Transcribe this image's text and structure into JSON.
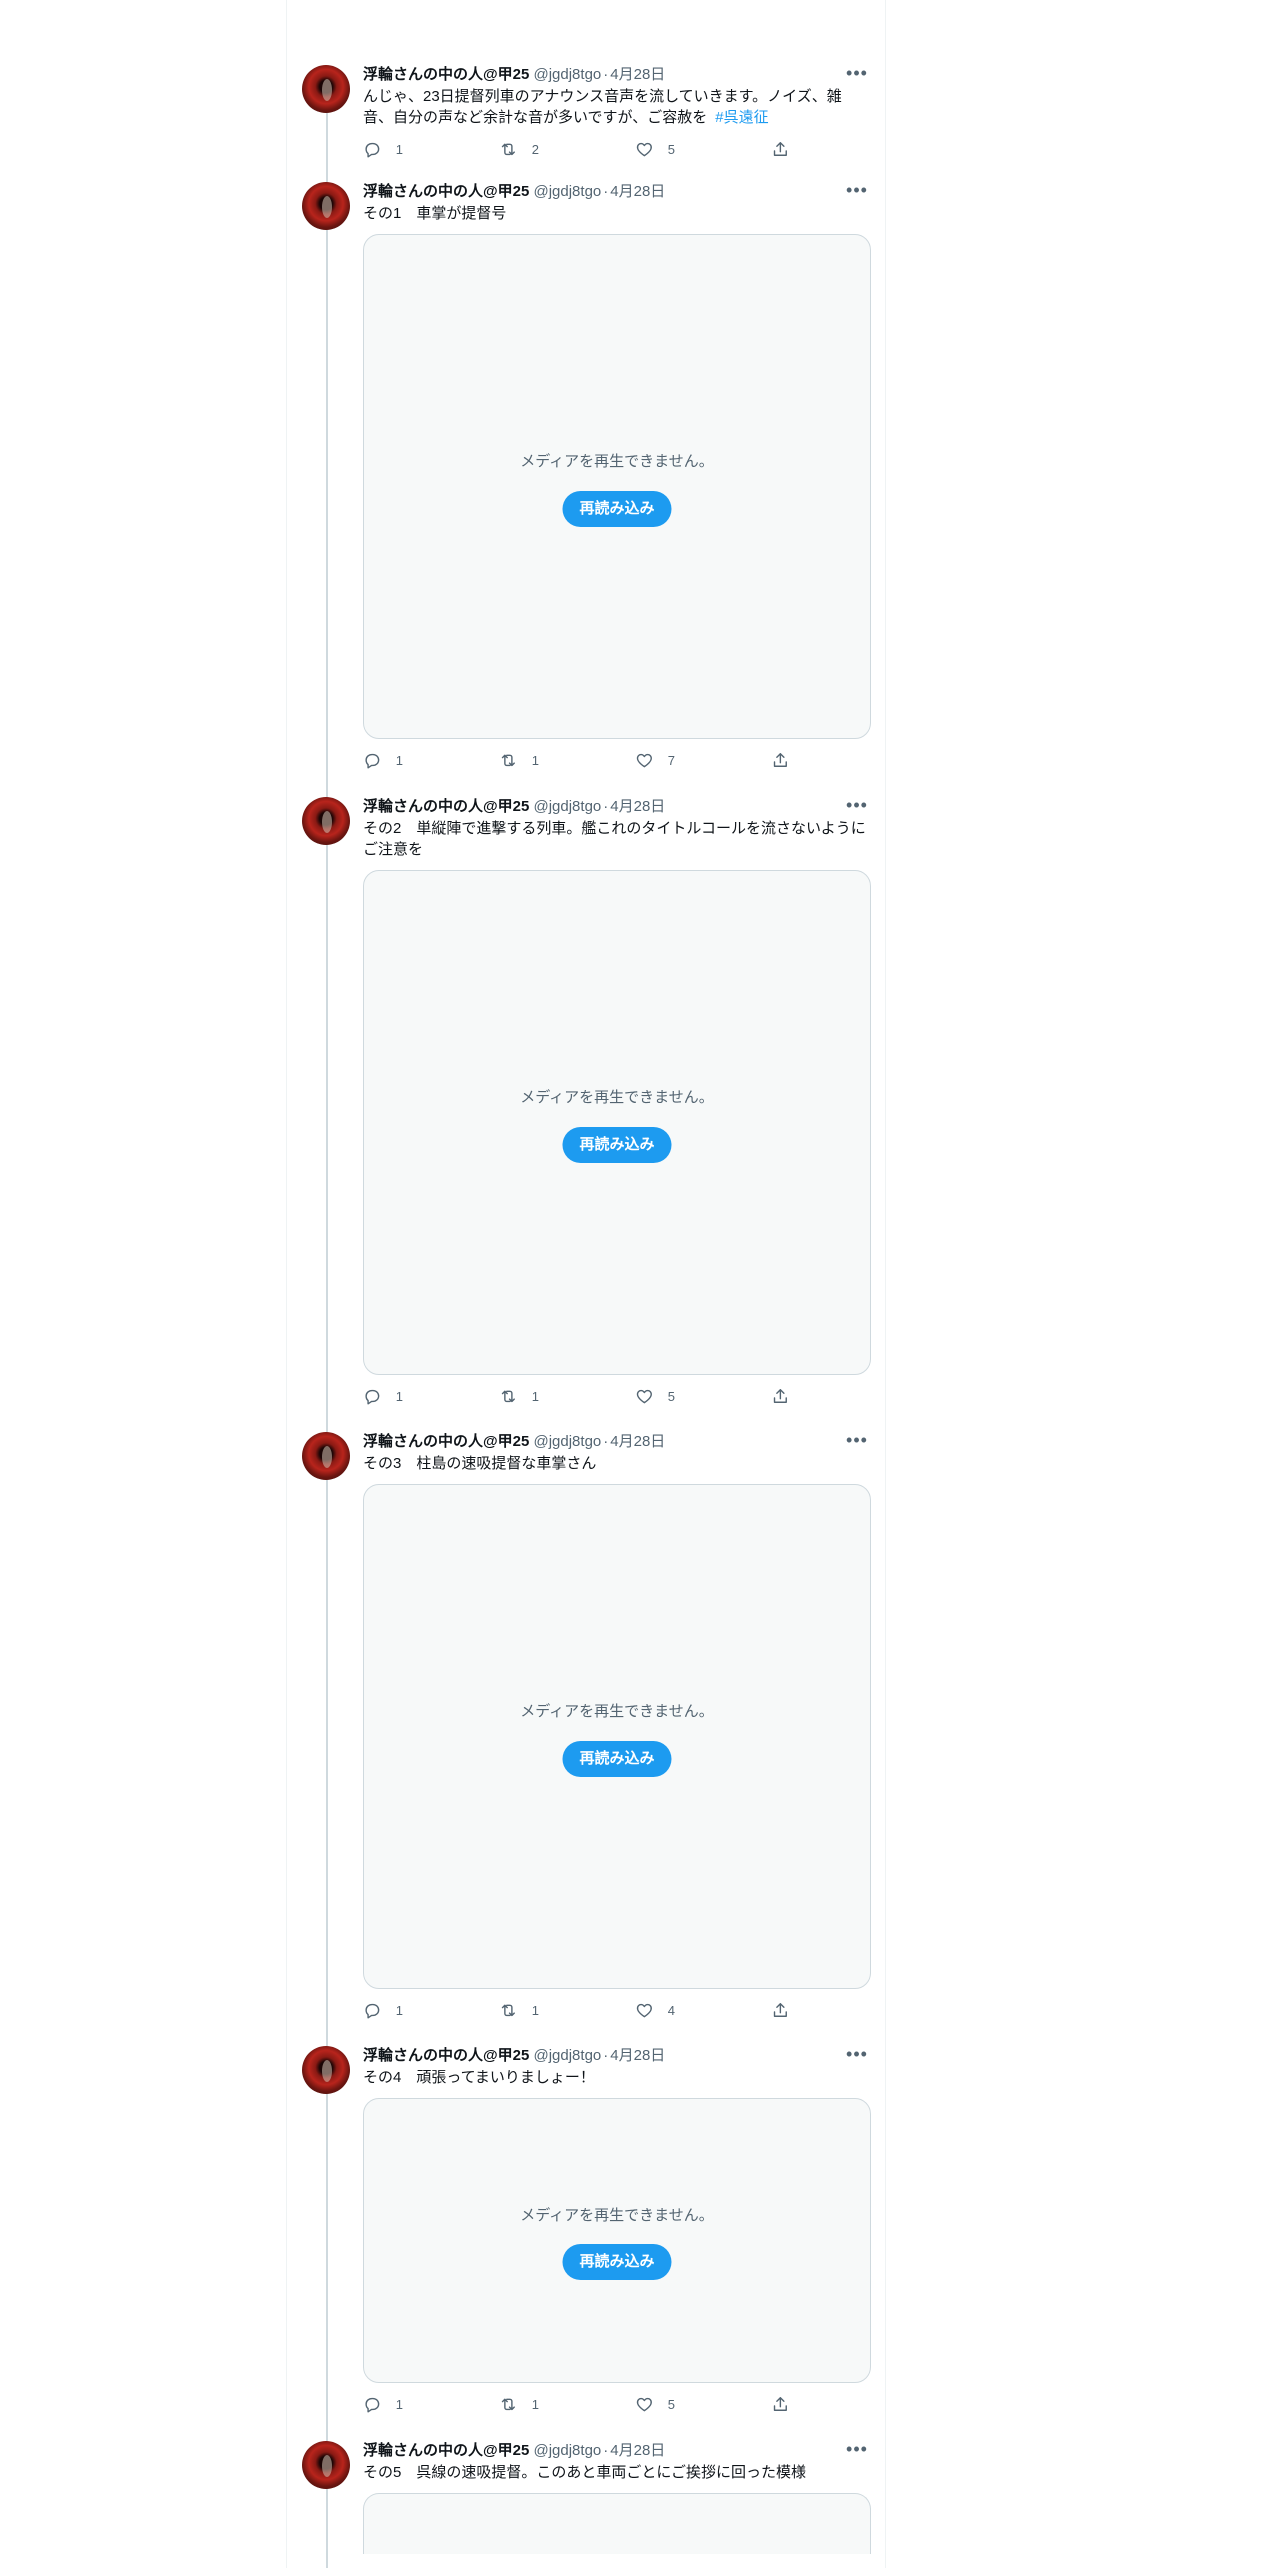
{
  "author": {
    "name": "浮輪さんの中の人@甲25",
    "handle": "@jgdj8tgo"
  },
  "tweets": [
    {
      "date": "4月28日",
      "text": "んじゃ、23日提督列車のアナウンス音声を流していきます。ノイズ、雑音、自分の声など余計な音が多いですが、ご容赦を",
      "hashtag": "#呉遠征",
      "replies": "1",
      "retweets": "2",
      "likes": "5"
    },
    {
      "date": "4月28日",
      "text": "その1　車掌が提督号",
      "media_message": "メディアを再生できません。",
      "reload_label": "再読み込み",
      "replies": "1",
      "retweets": "1",
      "likes": "7"
    },
    {
      "date": "4月28日",
      "text": "その2　単縦陣で進撃する列車。艦これのタイトルコールを流さないようにご注意を",
      "media_message": "メディアを再生できません。",
      "reload_label": "再読み込み",
      "replies": "1",
      "retweets": "1",
      "likes": "5"
    },
    {
      "date": "4月28日",
      "text": "その3　柱島の速吸提督な車掌さん",
      "media_message": "メディアを再生できません。",
      "reload_label": "再読み込み",
      "replies": "1",
      "retweets": "1",
      "likes": "4"
    },
    {
      "date": "4月28日",
      "text": "その4　頑張ってまいりましょー！",
      "media_message": "メディアを再生できません。",
      "reload_label": "再読み込み",
      "replies": "1",
      "retweets": "1",
      "likes": "5"
    },
    {
      "date": "4月28日",
      "text": "その5　呉線の速吸提督。このあと車両ごとにご挨拶に回った模様"
    }
  ],
  "icons": {
    "reply": "reply-icon",
    "retweet": "retweet-icon",
    "like": "heart-icon",
    "share": "share-icon",
    "more": "more-icon"
  },
  "colors": {
    "accent": "#1d9bf0",
    "text": "#0f1419",
    "muted": "#536471",
    "media_bg": "#f7f9f9"
  }
}
